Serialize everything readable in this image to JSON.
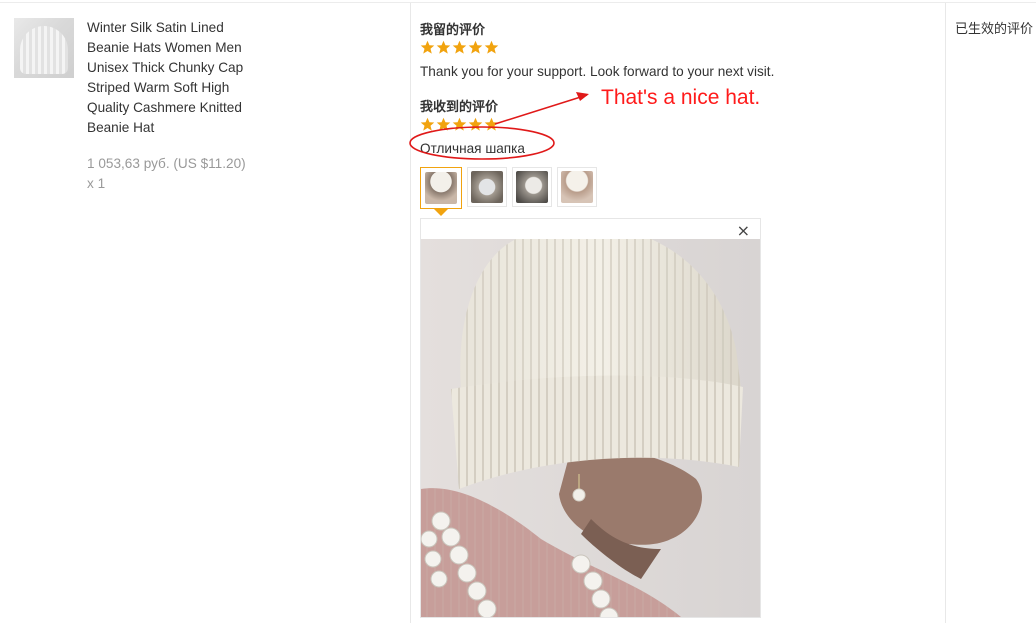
{
  "product": {
    "title": "Winter Silk Satin Lined Beanie Hats Women Men Unisex Thick Chunky Cap Striped Warm Soft High Quality Cashmere Knitted Beanie Hat",
    "price": "1 053,63 руб. (US $11.20)",
    "quantity": "x 1",
    "thumbnail": "white-knit-beanie-image"
  },
  "my_feedback": {
    "heading": "我留的评价",
    "rating": 5,
    "text": "Thank you for your support. Look forward to your next visit."
  },
  "received_feedback": {
    "heading": "我收到的评价",
    "rating": 5,
    "text": "Отличная шапка",
    "photos": [
      "photo-1",
      "photo-2",
      "photo-3",
      "photo-4"
    ],
    "active_photo": 0
  },
  "viewer": {
    "close_icon": "×"
  },
  "status": {
    "text": "已生效的评价"
  },
  "annotation": {
    "text": "That's a nice hat.",
    "color": "#ff1a1a"
  },
  "colors": {
    "star": "#f1a30f",
    "annotation": "#ff1a1a"
  }
}
